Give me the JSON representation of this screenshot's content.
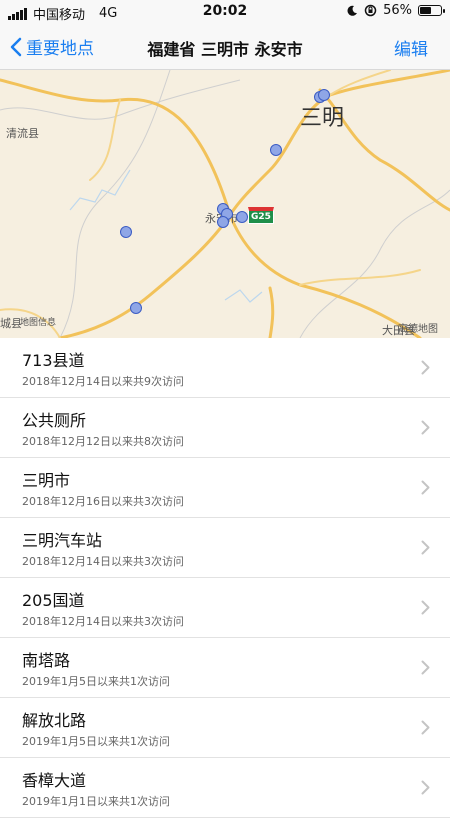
{
  "status": {
    "carrier": "中国移动",
    "network": "4G",
    "time": "20:02",
    "battery": "56%",
    "battery_level": 0.56
  },
  "nav": {
    "back_label": "重要地点",
    "title": "福建省 三明市 永安市",
    "edit_label": "编辑"
  },
  "map": {
    "labels": {
      "qingliu": "清流县",
      "sanming": "三明",
      "highway": "G25",
      "yongan": "永安市",
      "damage": "城县",
      "info": "地图信息",
      "datian": "大田县",
      "baidu_map": "高德地图"
    }
  },
  "places": [
    {
      "name": "713县道",
      "visits": "2018年12月14日以来共9次访问"
    },
    {
      "name": "公共厕所",
      "visits": "2018年12月12日以来共8次访问"
    },
    {
      "name": "三明市",
      "visits": "2018年12月16日以来共3次访问"
    },
    {
      "name": "三明汽车站",
      "visits": "2018年12月14日以来共3次访问"
    },
    {
      "name": "205国道",
      "visits": "2018年12月14日以来共3次访问"
    },
    {
      "name": "南塔路",
      "visits": "2019年1月5日以来共1次访问"
    },
    {
      "name": "解放北路",
      "visits": "2019年1月5日以来共1次访问"
    },
    {
      "name": "香樟大道",
      "visits": "2019年1月1日以来共1次访问"
    }
  ],
  "colors": {
    "accent": "#1a7ef0",
    "road": "#f2c25a",
    "pin": "#8fa6e6"
  }
}
